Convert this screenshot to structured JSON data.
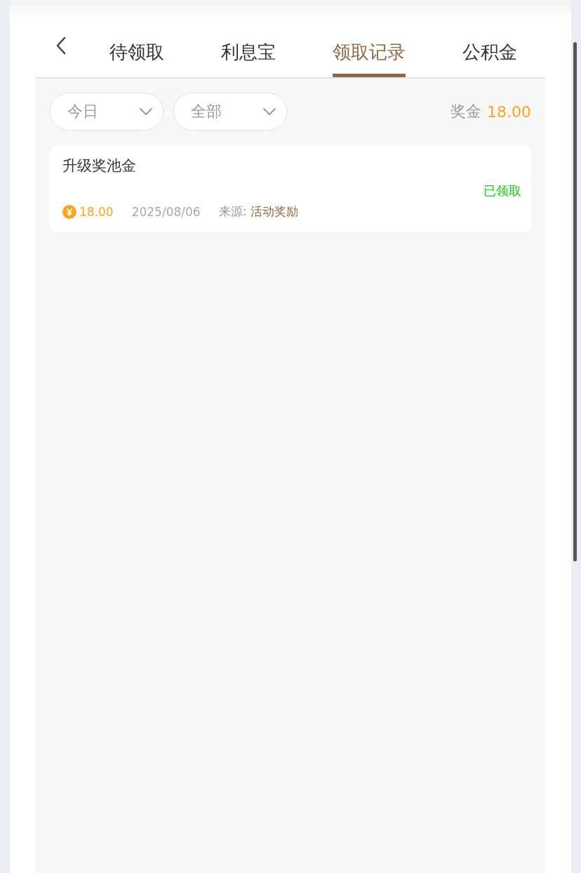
{
  "tabs": [
    {
      "label": "待领取",
      "selected": false
    },
    {
      "label": "利息宝",
      "selected": false
    },
    {
      "label": "领取记录",
      "selected": true
    },
    {
      "label": "公积金",
      "selected": false
    }
  ],
  "filters": [
    {
      "value": "今日"
    },
    {
      "value": "全部"
    }
  ],
  "total": {
    "label": "奖金",
    "amount": "18.00"
  },
  "records": [
    {
      "title": "升级奖池金",
      "status": "已领取",
      "amount": "18.00",
      "date": "2025/08/06",
      "source_label": "来源:",
      "source": "活动奖励"
    }
  ]
}
